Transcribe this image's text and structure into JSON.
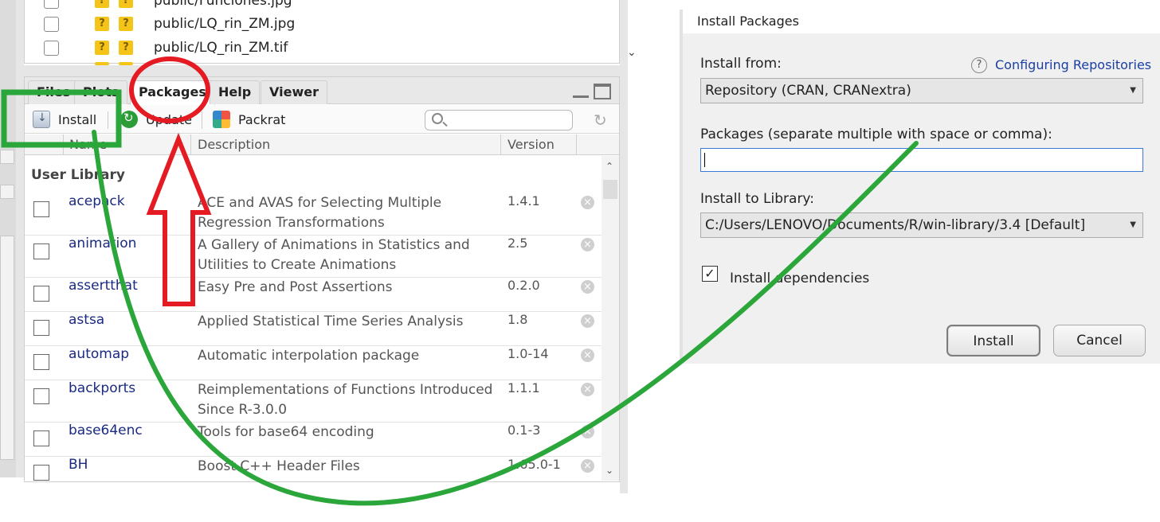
{
  "files": {
    "rows": [
      {
        "name": "public/Funciones.jpg"
      },
      {
        "name": "public/LQ_rin_ZM.jpg"
      },
      {
        "name": "public/LQ_rin_ZM.tif"
      }
    ]
  },
  "tabs": [
    {
      "label": "Files"
    },
    {
      "label": "Plots"
    },
    {
      "label": "Packages"
    },
    {
      "label": "Help"
    },
    {
      "label": "Viewer"
    }
  ],
  "toolbar": {
    "install_label": "Install",
    "update_label": "Update",
    "packrat_label": "Packrat",
    "search_value": ""
  },
  "table": {
    "headers": {
      "name": "Name",
      "description": "Description",
      "version": "Version"
    },
    "section": "User Library",
    "rows": [
      {
        "name": "acepack",
        "description": "ACE and AVAS for Selecting Multiple Regression Transformations",
        "version": "1.4.1"
      },
      {
        "name": "animation",
        "description": "A Gallery of Animations in Statistics and Utilities to Create Animations",
        "version": "2.5"
      },
      {
        "name": "assertthat",
        "description": "Easy Pre and Post Assertions",
        "version": "0.2.0"
      },
      {
        "name": "astsa",
        "description": "Applied Statistical Time Series Analysis",
        "version": "1.8"
      },
      {
        "name": "automap",
        "description": "Automatic interpolation package",
        "version": "1.0-14"
      },
      {
        "name": "backports",
        "description": "Reimplementations of Functions Introduced Since R-3.0.0",
        "version": "1.1.1"
      },
      {
        "name": "base64enc",
        "description": "Tools for base64 encoding",
        "version": "0.1-3"
      },
      {
        "name": "BH",
        "description": "Boost C++ Header Files",
        "version": "1.65.0-1"
      }
    ]
  },
  "dialog": {
    "title": "Install Packages",
    "install_from_label": "Install from:",
    "help_link": "Configuring Repositories",
    "install_from_value": "Repository (CRAN, CRANextra)",
    "packages_label": "Packages (separate multiple with space or comma):",
    "packages_value": "",
    "library_label": "Install to Library:",
    "library_value": "C:/Users/LENOVO/Documents/R/win-library/3.4 [Default]",
    "dependencies_label": "Install dependencies",
    "dependencies_checked": true,
    "install_button": "Install",
    "cancel_button": "Cancel"
  },
  "colors": {
    "annotation_red": "#e41b23",
    "annotation_green": "#2aa63a",
    "link_blue": "#1b3fa3",
    "package_name": "#1a2a80"
  }
}
